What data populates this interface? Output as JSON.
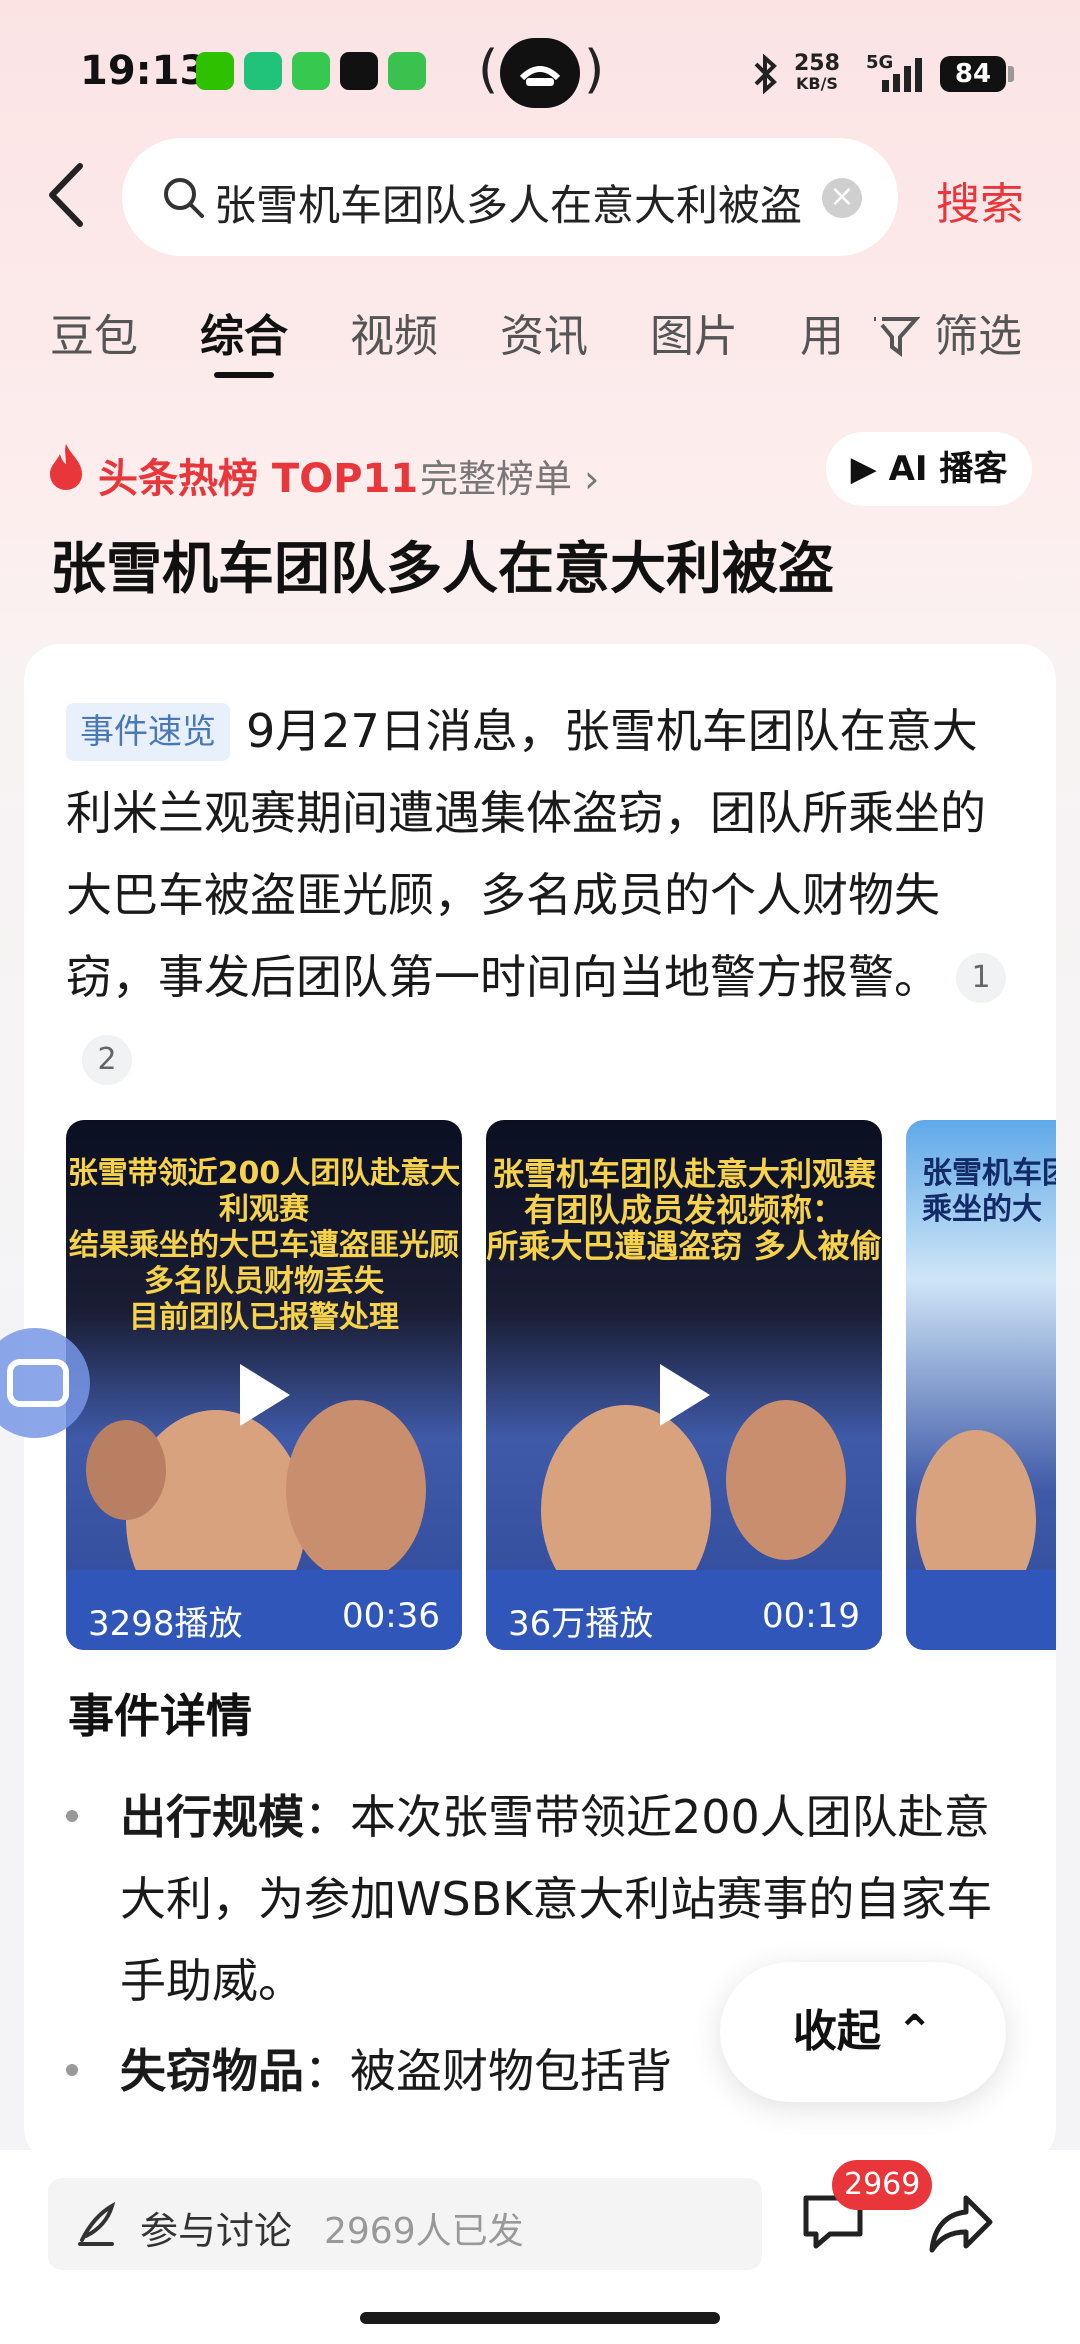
{
  "status_bar": {
    "time": "19:13",
    "net_speed_value": "258",
    "net_speed_unit": "KB/S",
    "signal_label": "5G",
    "battery": "84"
  },
  "search": {
    "query": "张雪机车团队多人在意大利被盗",
    "button": "搜索"
  },
  "tabs": [
    "豆包",
    "综合",
    "视频",
    "资讯",
    "图片",
    "用"
  ],
  "filter_label": "筛选",
  "hot": {
    "label": "头条热榜 TOP11",
    "full_list": "完整榜单 ›",
    "ai_button": "▶ AI 播客"
  },
  "headline": "张雪机车团队多人在意大利被盗",
  "summary": {
    "tag": "事件速览",
    "text": "9月27日消息，张雪机车团队在意大利米兰观赛期间遭遇集体盗窃，团队所乘坐的大巴车被盗匪光顾，多名成员的个人财物失窃，事发后团队第一时间向当地警方报警。",
    "cite1": "1",
    "cite2": "2"
  },
  "videos": [
    {
      "title": "张雪带领近200人团队赴意大利观赛\n结果乘坐的大巴车遭盗匪光顾\n多名队员财物丢失\n目前团队已报警处理",
      "views": "3298播放",
      "duration": "00:36"
    },
    {
      "title": "张雪机车团队赴意大利观赛\n有团队成员发视频称：\n所乘大巴遭遇盗窃 多人被偷",
      "views": "36万播放",
      "duration": "00:19"
    },
    {
      "title": "张雪机车团队\n乘坐的大",
      "views": "",
      "duration": ""
    }
  ],
  "details": {
    "title": "事件详情",
    "items": [
      {
        "label": "出行规模",
        "sep": "：",
        "text": "本次张雪带领近200人团队赴意大利，为参加WSBK意大利站赛事的自家车手助威。"
      },
      {
        "label": "失窃物品",
        "sep": "：",
        "text": "被盗财物包括背"
      }
    ]
  },
  "collapse_button": "收起 ⌃",
  "bottom": {
    "discuss_label": "参与讨论",
    "discuss_count": "2969人已发",
    "comment_badge": "2969"
  },
  "colors": {
    "accent_red": "#e8363b",
    "tag_blue": "#4a78b5"
  }
}
